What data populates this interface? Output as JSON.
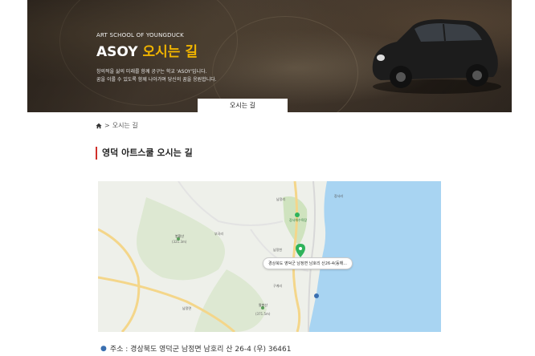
{
  "hero": {
    "subtitle": "ART SCHOOL OF YOUNGDUCK",
    "title_main": "ASOY",
    "title_accent": "오시는 길",
    "desc_line1": "창의적을 삶의 미래를 함께 공구는 학교 'ASOY'입니다.",
    "desc_line2": "꿈을 이룰 수 있도록 함께 나아가며 당신의 꿈을 응원합니다.",
    "tab_label": "오시는 길"
  },
  "breadcrumb": {
    "home_icon": "home-icon",
    "current": "오시는 길"
  },
  "section": {
    "title": "영덕 아트스쿨 오시는 길"
  },
  "map": {
    "popup_text": "경상북도 영덕군 남정면 남호리 산26-4(동해...",
    "labels": {
      "mountain1": "봉황산",
      "mountain1_height": "(321.3m)",
      "mountain2": "팔봉산",
      "mountain2_height": "(371.5m)",
      "town1": "남정리",
      "town2": "부곡리",
      "town3": "남정면",
      "town4": "구계리",
      "town5": "장사리",
      "town6": "남정천",
      "place1": "장사해수욕장"
    },
    "colors": {
      "sea": "#a8d4f2",
      "land": "#eef0ea",
      "green": "#cfe3bf",
      "road": "#f4d68a",
      "pin": "#2fb35b"
    }
  },
  "address": {
    "text": "주소 : 경상북도 영덕군 남정면 남호리 산 26-4 (우) 36461"
  }
}
